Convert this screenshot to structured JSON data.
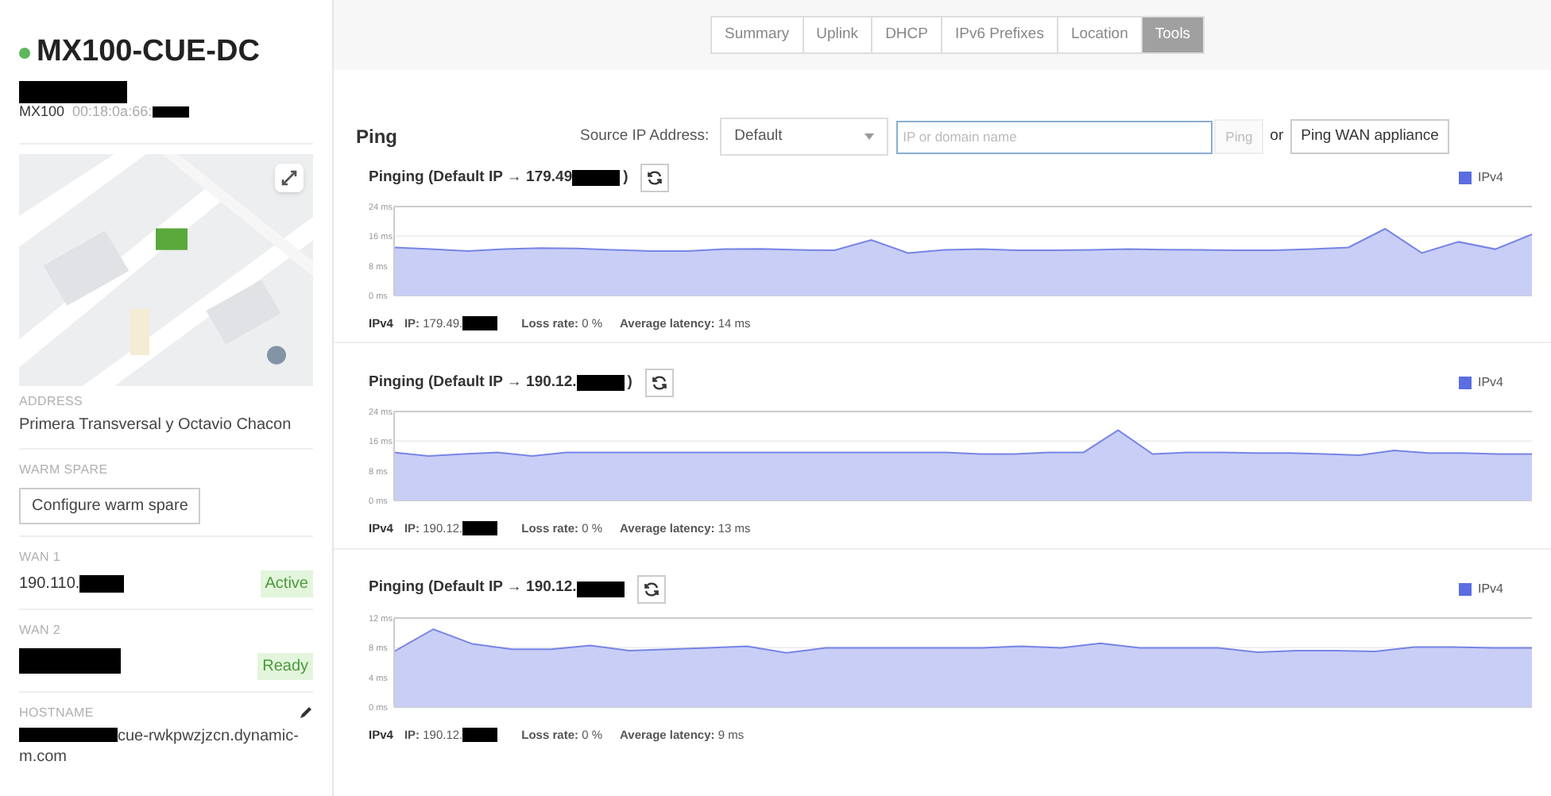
{
  "sidebar": {
    "device": {
      "name": "MX100-CUE-DC",
      "online": true,
      "subtitle_redacted": true,
      "model": "MX100",
      "mac": {
        "text": "00:18:0a:66:",
        "redacted": true
      }
    },
    "address": {
      "label": "ADDRESS",
      "value": "Primera Transversal y Octavio Chacon"
    },
    "warm_spare": {
      "label": "WARM SPARE",
      "button": "Configure warm spare"
    },
    "wans": [
      {
        "label": "WAN 1",
        "value": {
          "text": "190.110.",
          "redacted": true
        },
        "status": "Active"
      },
      {
        "label": "WAN 2",
        "value": {
          "redacted": true
        },
        "status": "Ready"
      }
    ],
    "hostname": {
      "label": "HOSTNAME",
      "value": {
        "text": "cue-rwkpwzjzcn.dynamic-m.com",
        "redacted": true
      }
    }
  },
  "tabs": [
    {
      "label": "Summary",
      "selected": false
    },
    {
      "label": "Uplink",
      "selected": false
    },
    {
      "label": "DHCP",
      "selected": false
    },
    {
      "label": "IPv6 Prefixes",
      "selected": false
    },
    {
      "label": "Location",
      "selected": false
    },
    {
      "label": "Tools",
      "selected": true
    }
  ],
  "ping": {
    "title": "Ping",
    "source_label": "Source IP Address:",
    "source_value": "Default",
    "target_placeholder": "IP or domain name",
    "ping_button": {
      "label": "Ping",
      "disabled": true
    },
    "or_text": "or",
    "wan_button": "Ping WAN appliance"
  },
  "results": [
    {
      "title_prefix": "Pinging (Default IP → 179.49",
      "title_suffix": ")",
      "protocol": "IPv4",
      "ip": {
        "text": "**IP:** 179.49.",
        "redacted": true
      },
      "loss": "**Loss rate:** 0 %",
      "latency": "**Average latency:** 14 ms",
      "chart_data": {
        "type": "area",
        "ylim": [
          0,
          24
        ],
        "yticks": [
          {
            "value": 0,
            "label": "0 ms"
          },
          {
            "value": 8,
            "label": "8 ms"
          },
          {
            "value": 16,
            "label": "16 ms"
          },
          {
            "value": 24,
            "label": "24 ms"
          }
        ],
        "series": [
          {
            "name": "IPv4",
            "color": "#5b6de0",
            "values": [
              13,
              12.5,
              12,
              12.5,
              12.8,
              12.7,
              12.3,
              12,
              12,
              12.5,
              12.6,
              12.3,
              12.2,
              15,
              11.5,
              12.3,
              12.5,
              12.2,
              12.2,
              12.3,
              12.5,
              12.4,
              12.3,
              12.2,
              12.2,
              12.5,
              13,
              18,
              11.5,
              14.5,
              12.5,
              16.5
            ]
          }
        ]
      }
    },
    {
      "title_prefix": "Pinging (Default IP → 190.12.",
      "title_suffix": ")",
      "protocol": "IPv4",
      "ip": {
        "text": "**IP:** 190.12.",
        "redacted": true
      },
      "loss": "**Loss rate:** 0 %",
      "latency": "**Average latency:** 13 ms",
      "chart_data": {
        "type": "area",
        "ylim": [
          0,
          24
        ],
        "yticks": [
          {
            "value": 0,
            "label": "0 ms"
          },
          {
            "value": 8,
            "label": "8 ms"
          },
          {
            "value": 16,
            "label": "16 ms"
          },
          {
            "value": 24,
            "label": "24 ms"
          }
        ],
        "series": [
          {
            "name": "IPv4",
            "color": "#5b6de0",
            "values": [
              13,
              12,
              12.5,
              13,
              12,
              13,
              13,
              13,
              13,
              13,
              13,
              13,
              13,
              13,
              13,
              13,
              13,
              12.5,
              12.5,
              13,
              13,
              19,
              12.5,
              13,
              13,
              12.8,
              12.8,
              12.5,
              12.2,
              13.5,
              12.8,
              12.8,
              12.5,
              12.5
            ]
          }
        ]
      }
    },
    {
      "title_prefix": "Pinging (Default IP → 190.12.",
      "protocol": "IPv4",
      "ip": {
        "text": "**IP:** 190.12.",
        "redacted": true
      },
      "loss": "**Loss rate:** 0 %",
      "latency": "**Average latency:** 9 ms",
      "chart_data": {
        "type": "area",
        "ylim": [
          0,
          12
        ],
        "yticks": [
          {
            "value": 0,
            "label": "0 ms"
          },
          {
            "value": 4,
            "label": "4 ms"
          },
          {
            "value": 8,
            "label": "8 ms"
          },
          {
            "value": 12,
            "label": "12 ms"
          }
        ],
        "series": [
          {
            "name": "IPv4",
            "color": "#5b6de0",
            "values": [
              7.5,
              10.5,
              8.5,
              7.8,
              7.8,
              8.3,
              7.6,
              7.8,
              8,
              8.2,
              7.3,
              8,
              8,
              8,
              8,
              8,
              8.2,
              8,
              8.6,
              8,
              8,
              8,
              7.4,
              7.6,
              7.6,
              7.5,
              8.1,
              8.1,
              8,
              8
            ]
          }
        ]
      }
    }
  ]
}
